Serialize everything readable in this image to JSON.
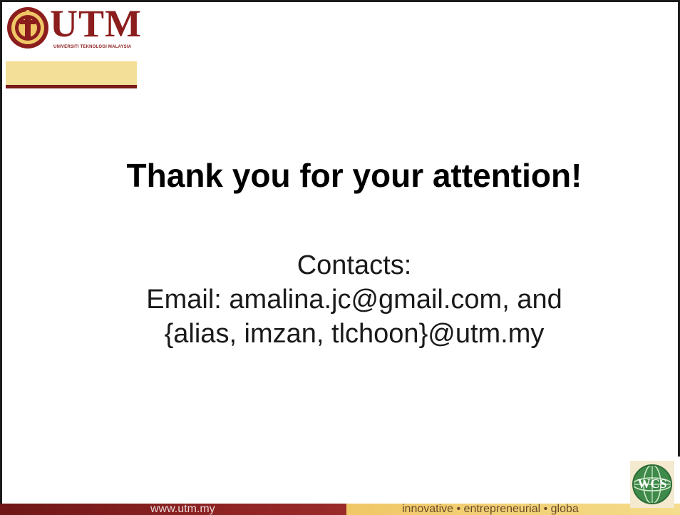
{
  "header": {
    "logo_text": "UTM",
    "logo_subtitle": "UNIVERSITI TEKNOLOGI MALAYSIA"
  },
  "main": {
    "title": "Thank you for your attention!",
    "contacts_label": "Contacts:",
    "contact_lines": [
      "Email: amalina.jc@gmail.com, and",
      "{alias, imzan, tlchoon}@utm.my"
    ]
  },
  "footer": {
    "url": "www.utm.my",
    "tagline": "innovative • entrepreneurial • globa"
  },
  "badge": {
    "text": "WCS"
  },
  "colors": {
    "brand_maroon": "#8c1d1d",
    "gold_band": "#f3df98",
    "footer_left": "#7b1a1a",
    "footer_right": "#f3d57e",
    "badge_green": "#3f8a4a"
  }
}
